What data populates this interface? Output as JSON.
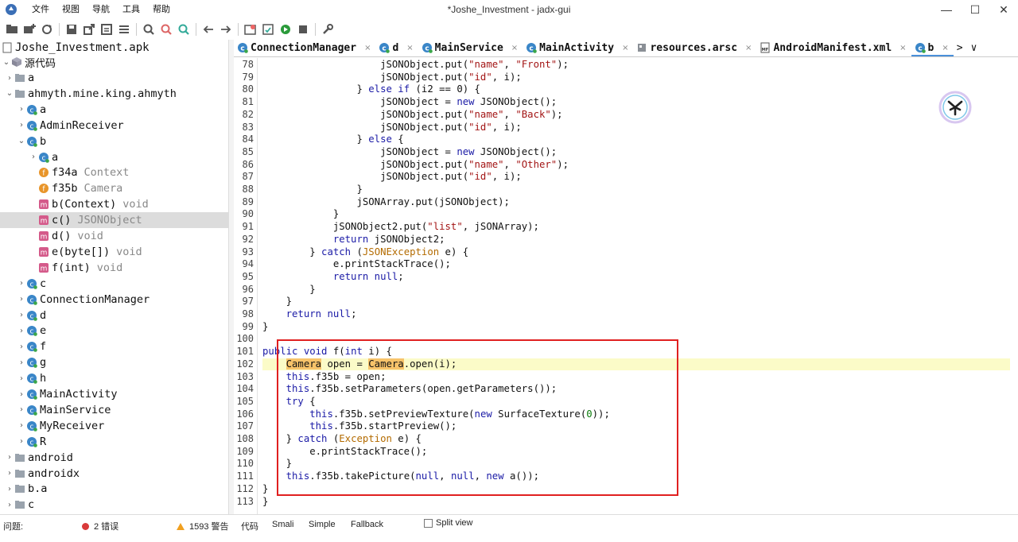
{
  "window": {
    "title": "*Joshe_Investment - jadx-gui",
    "minimize": "—",
    "maximize": "☐",
    "close": "✕"
  },
  "menu": [
    "文件",
    "视图",
    "导航",
    "工具",
    "帮助"
  ],
  "toolbar_icons": [
    "open-icon",
    "add-icon",
    "refresh-icon",
    "save-icon",
    "export-icon",
    "sync-icon",
    "flatten-icon",
    "search-icon",
    "search-class-icon",
    "search-usage-icon",
    "back-icon",
    "forward-icon",
    "decompile-icon",
    "log-icon",
    "run-icon",
    "quark-icon",
    "settings-icon"
  ],
  "tree": {
    "root": "Joshe_Investment.apk",
    "source_label": "源代码",
    "items": [
      {
        "label": "a",
        "type": "",
        "kind": "package"
      },
      {
        "label": "ahmyth.mine.king.ahmyth",
        "type": "",
        "kind": "package"
      },
      {
        "label": "a",
        "type": "",
        "kind": "class"
      },
      {
        "label": "AdminReceiver",
        "type": "",
        "kind": "class"
      },
      {
        "label": "b",
        "type": "",
        "kind": "class"
      },
      {
        "label": "a",
        "type": "",
        "kind": "class"
      },
      {
        "label": "f34a",
        "type": "Context",
        "kind": "field"
      },
      {
        "label": "f35b",
        "type": "Camera",
        "kind": "field"
      },
      {
        "label": "b(Context)",
        "type": "void",
        "kind": "method"
      },
      {
        "label": "c()",
        "type": "JSONObject",
        "kind": "method"
      },
      {
        "label": "d()",
        "type": "void",
        "kind": "method"
      },
      {
        "label": "e(byte[])",
        "type": "void",
        "kind": "method"
      },
      {
        "label": "f(int)",
        "type": "void",
        "kind": "method"
      },
      {
        "label": "c",
        "type": "",
        "kind": "class"
      },
      {
        "label": "ConnectionManager",
        "type": "",
        "kind": "class"
      },
      {
        "label": "d",
        "type": "",
        "kind": "class"
      },
      {
        "label": "e",
        "type": "",
        "kind": "class"
      },
      {
        "label": "f",
        "type": "",
        "kind": "class"
      },
      {
        "label": "g",
        "type": "",
        "kind": "class"
      },
      {
        "label": "h",
        "type": "",
        "kind": "class"
      },
      {
        "label": "MainActivity",
        "type": "",
        "kind": "class"
      },
      {
        "label": "MainService",
        "type": "",
        "kind": "class"
      },
      {
        "label": "MyReceiver",
        "type": "",
        "kind": "class"
      },
      {
        "label": "R",
        "type": "",
        "kind": "class"
      },
      {
        "label": "android",
        "type": "",
        "kind": "package"
      },
      {
        "label": "androidx",
        "type": "",
        "kind": "package"
      },
      {
        "label": "b.a",
        "type": "",
        "kind": "package"
      },
      {
        "label": "c",
        "type": "",
        "kind": "package"
      }
    ]
  },
  "tabs": [
    {
      "label": "ConnectionManager",
      "icon": "class",
      "active": false
    },
    {
      "label": "d",
      "icon": "class",
      "active": false
    },
    {
      "label": "MainService",
      "icon": "class",
      "active": false
    },
    {
      "label": "MainActivity",
      "icon": "class",
      "active": false
    },
    {
      "label": "resources.arsc",
      "icon": "file",
      "active": false
    },
    {
      "label": "AndroidManifest.xml",
      "icon": "manifest",
      "active": false
    },
    {
      "label": "b",
      "icon": "class",
      "active": true
    }
  ],
  "tab_close": "×",
  "tab_more": ">",
  "tab_dropdown": "∨",
  "code": {
    "first_line": 78,
    "highlight_line": 102,
    "lines": [
      "                    jSONObject.put(\"name\", \"Front\");",
      "                    jSONObject.put(\"id\", i);",
      "                } else if (i2 == 0) {",
      "                    jSONObject = new JSONObject();",
      "                    jSONObject.put(\"name\", \"Back\");",
      "                    jSONObject.put(\"id\", i);",
      "                } else {",
      "                    jSONObject = new JSONObject();",
      "                    jSONObject.put(\"name\", \"Other\");",
      "                    jSONObject.put(\"id\", i);",
      "                }",
      "                jSONArray.put(jSONObject);",
      "            }",
      "            jSONObject2.put(\"list\", jSONArray);",
      "            return jSONObject2;",
      "        } catch (JSONException e) {",
      "            e.printStackTrace();",
      "            return null;",
      "        }",
      "    }",
      "    return null;",
      "}",
      "",
      "public void f(int i) {",
      "    Camera open = Camera.open(i);",
      "    this.f35b = open;",
      "    this.f35b.setParameters(open.getParameters());",
      "    try {",
      "        this.f35b.setPreviewTexture(new SurfaceTexture(0));",
      "        this.f35b.startPreview();",
      "    } catch (Exception e) {",
      "        e.printStackTrace();",
      "    }",
      "    this.f35b.takePicture(null, null, new a());",
      "}",
      "}"
    ]
  },
  "bottom": {
    "problems_label": "问题:",
    "errors": "2 错误",
    "warnings": "1593 警告",
    "view_tabs": [
      "代码",
      "Smali",
      "Simple",
      "Fallback"
    ],
    "split_view": "Split view"
  }
}
